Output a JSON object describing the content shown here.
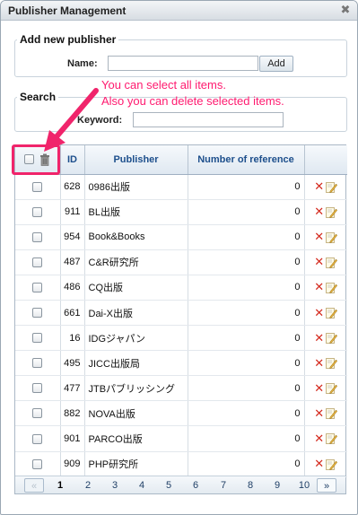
{
  "window": {
    "title": "Publisher Management",
    "close_glyph": "✖"
  },
  "add_panel": {
    "legend": "Add new publisher",
    "name_label": "Name:",
    "name_value": "",
    "add_button": "Add"
  },
  "search_panel": {
    "legend": "Search",
    "keyword_label": "Keyword:",
    "keyword_value": ""
  },
  "annotations": {
    "line1": "You can select all items.",
    "line2": "Also you can delete selected items.",
    "color": "#f0246b"
  },
  "table": {
    "headers": {
      "id": "ID",
      "publisher": "Publisher",
      "refs": "Number of reference"
    },
    "rows": [
      {
        "id": "628",
        "publisher": "0986出版",
        "refs": "0"
      },
      {
        "id": "911",
        "publisher": "BL出版",
        "refs": "0"
      },
      {
        "id": "954",
        "publisher": "Book&Books",
        "refs": "0"
      },
      {
        "id": "487",
        "publisher": "C&R研究所",
        "refs": "0"
      },
      {
        "id": "486",
        "publisher": "CQ出版",
        "refs": "0"
      },
      {
        "id": "661",
        "publisher": "Dai-X出版",
        "refs": "0"
      },
      {
        "id": "16",
        "publisher": "IDGジャパン",
        "refs": "0"
      },
      {
        "id": "495",
        "publisher": "JICC出版局",
        "refs": "0"
      },
      {
        "id": "477",
        "publisher": "JTBパブリッシング",
        "refs": "0"
      },
      {
        "id": "882",
        "publisher": "NOVA出版",
        "refs": "0"
      },
      {
        "id": "901",
        "publisher": "PARCO出版",
        "refs": "0"
      },
      {
        "id": "909",
        "publisher": "PHP研究所",
        "refs": "0"
      }
    ],
    "delete_glyph": "✕"
  },
  "pager": {
    "prev": "«",
    "next": "»",
    "pages": [
      "1",
      "2",
      "3",
      "4",
      "5",
      "6",
      "7",
      "8",
      "9",
      "10"
    ],
    "current": "1"
  }
}
